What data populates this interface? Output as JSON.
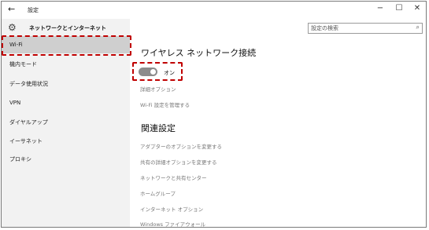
{
  "window": {
    "back_label": "←",
    "title": "設定",
    "min_label": "−",
    "max_label": "☐",
    "close_label": "✕"
  },
  "sidebar": {
    "app_name": "ネットワークとインターネット",
    "items": [
      {
        "label": "Wi-Fi",
        "active": true
      },
      {
        "label": "機内モード"
      },
      {
        "label": "データ使用状況"
      },
      {
        "label": "VPN"
      },
      {
        "label": "ダイヤルアップ"
      },
      {
        "label": "イーサネット"
      },
      {
        "label": "プロキシ"
      }
    ]
  },
  "search": {
    "placeholder": "設定の検索",
    "icon": "search-icon"
  },
  "main": {
    "heading": "ワイヤレス ネットワーク接続",
    "toggle_state": "オン",
    "advanced_options": "詳細オプション",
    "manage_wifi": "Wi-Fi 設定を管理する",
    "related_heading": "関連設定",
    "related_links": [
      "アダプターのオプションを変更する",
      "共有の詳細オプションを変更する",
      "ネットワークと共有センター",
      "ホームグループ",
      "インターネット オプション",
      "Windows ファイアウォール"
    ]
  },
  "colors": {
    "highlight": "#c00000",
    "sidebar_bg": "#f2f2f2",
    "active_bg": "#cfcfcf",
    "toggle": "#8c8c8c"
  }
}
